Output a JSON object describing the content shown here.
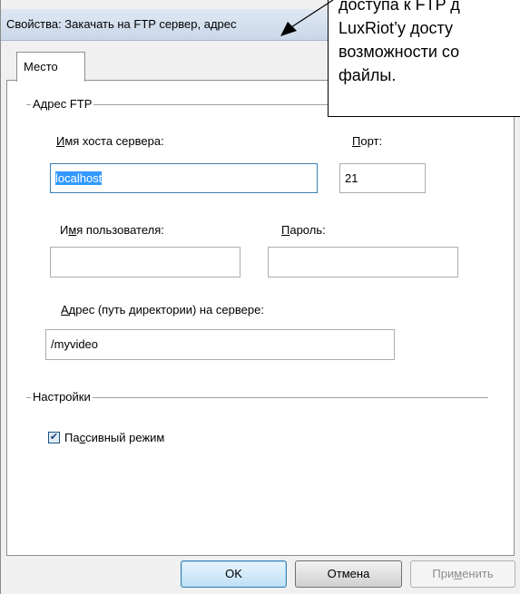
{
  "window": {
    "title": "Свойства: Закачать на FTP сервер, адрес"
  },
  "tabs": [
    {
      "label": "Место"
    }
  ],
  "groups": {
    "ftp_address": "Адрес FTP",
    "settings": "Настройки"
  },
  "fields": {
    "host": {
      "label_before": "",
      "label_key": "И",
      "label_after": "мя хоста сервера:",
      "value": "localhost"
    },
    "port": {
      "label_before": "",
      "label_key": "П",
      "label_after": "орт:",
      "value": "21"
    },
    "user": {
      "label_before": "И",
      "label_key": "м",
      "label_after": "я пользователя:",
      "value": ""
    },
    "password": {
      "label_before": "",
      "label_key": "П",
      "label_after": "ароль:",
      "value": ""
    },
    "path": {
      "label_before": "",
      "label_key": "А",
      "label_after": "дрес (путь директории) на сервере:",
      "value": "/myvideo"
    }
  },
  "passive_mode": {
    "label_before": "Па",
    "label_key": "с",
    "label_after": "сивный режим",
    "checked": true,
    "check_glyph": "✔"
  },
  "buttons": {
    "ok": "OK",
    "cancel": "Отмена",
    "apply_before": "При",
    "apply_key": "м",
    "apply_after": "енить"
  },
  "callout": {
    "text": "доступа к FTP д\nLuxRiot’у досту\nвозможности со\nфайлы."
  }
}
